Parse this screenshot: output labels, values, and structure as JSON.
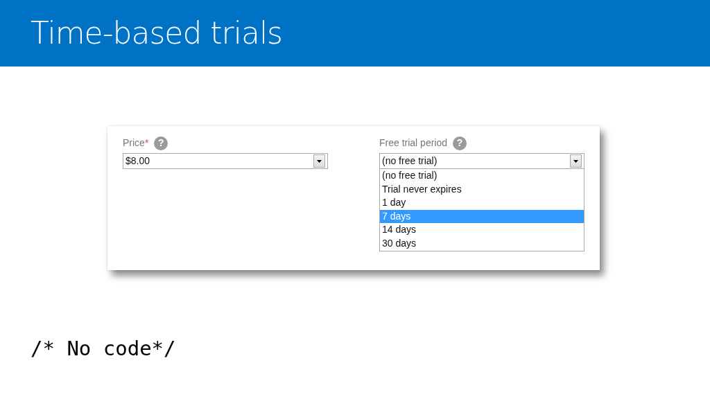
{
  "slide_title": "Time-based trials",
  "fields": [
    {
      "label": "Price",
      "required_mark": "*",
      "help_glyph": "?",
      "value": "$8.00"
    },
    {
      "label": "Free trial period",
      "help_glyph": "?",
      "value": "(no free trial)",
      "options": [
        {
          "label": "(no free trial)",
          "highlighted": false
        },
        {
          "label": "Trial never expires",
          "highlighted": false
        },
        {
          "label": "1 day",
          "highlighted": false
        },
        {
          "label": "7 days",
          "highlighted": true
        },
        {
          "label": "14 days",
          "highlighted": false
        },
        {
          "label": "30 days",
          "highlighted": false
        }
      ]
    }
  ],
  "code_note": "/* No code*/"
}
